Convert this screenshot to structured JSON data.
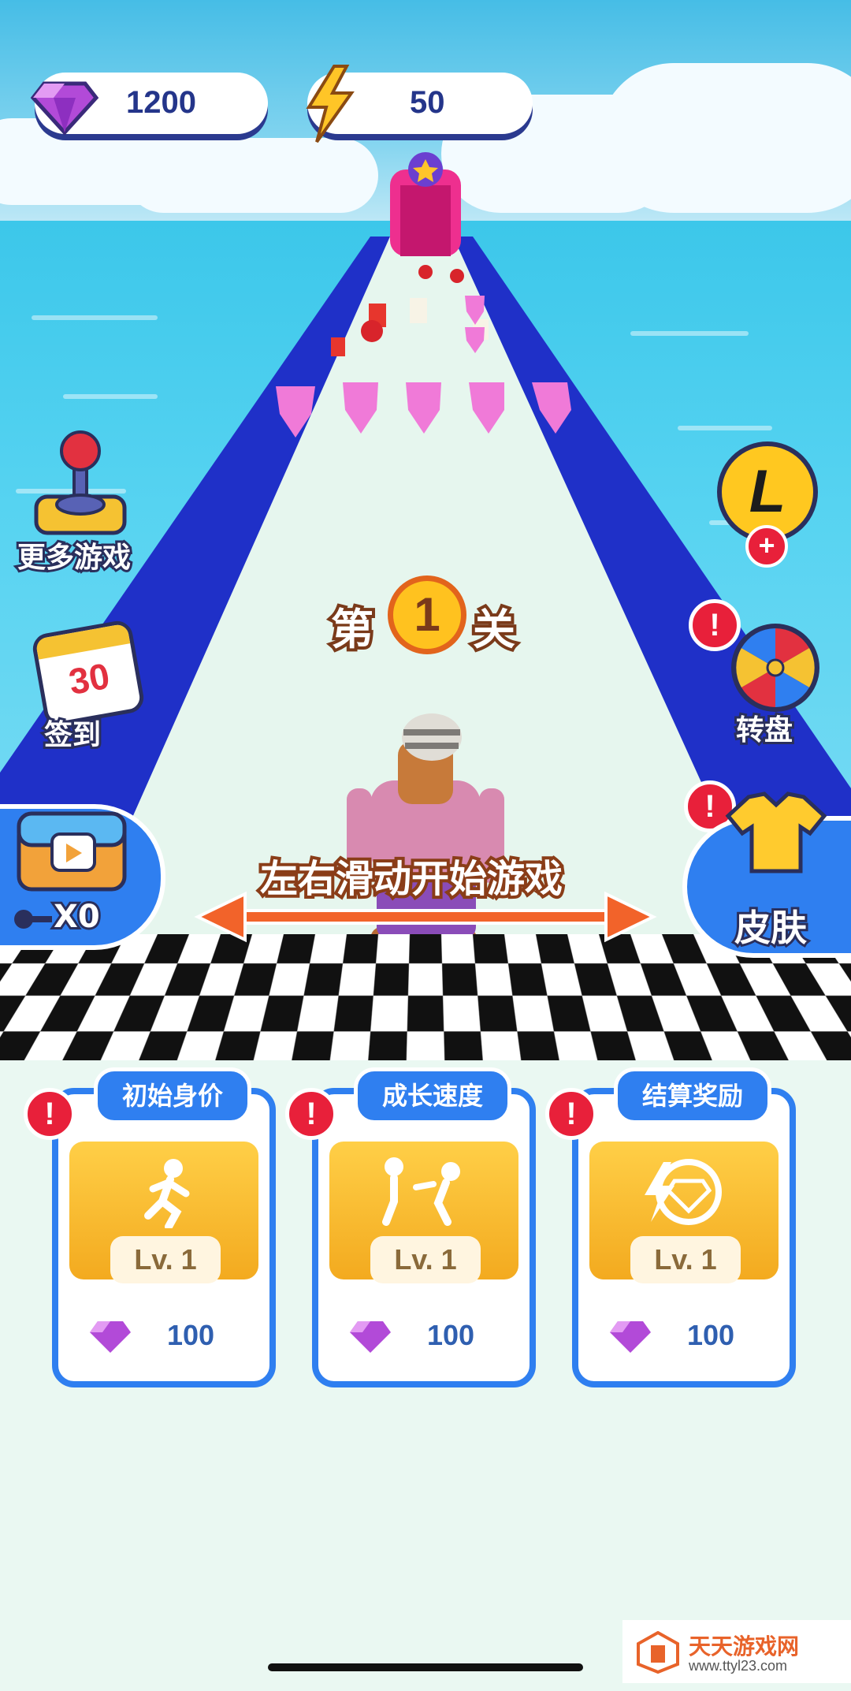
{
  "currency": {
    "gems": "1200",
    "energy": "50"
  },
  "side_buttons": {
    "more_games": "更多游戏",
    "checkin": "签到",
    "checkin_day": "30",
    "wheel": "转盘",
    "skin": "皮肤",
    "chest_keys": "X0",
    "L_badge": "L"
  },
  "level": {
    "prefix": "第",
    "number": "1",
    "suffix": "关"
  },
  "hint": "左右滑动开始游戏",
  "upgrades": [
    {
      "title": "初始身价",
      "level": "Lv. 1",
      "cost": "100"
    },
    {
      "title": "成长速度",
      "level": "Lv. 1",
      "cost": "100"
    },
    {
      "title": "结算奖励",
      "level": "Lv. 1",
      "cost": "100"
    }
  ],
  "watermark": {
    "name": "天天游戏网",
    "url": "www.ttyl23.com"
  },
  "colors": {
    "accent": "#2f7ff0",
    "gem": "#b24ad8",
    "alert": "#e8203a",
    "arrow": "#f2632a"
  }
}
